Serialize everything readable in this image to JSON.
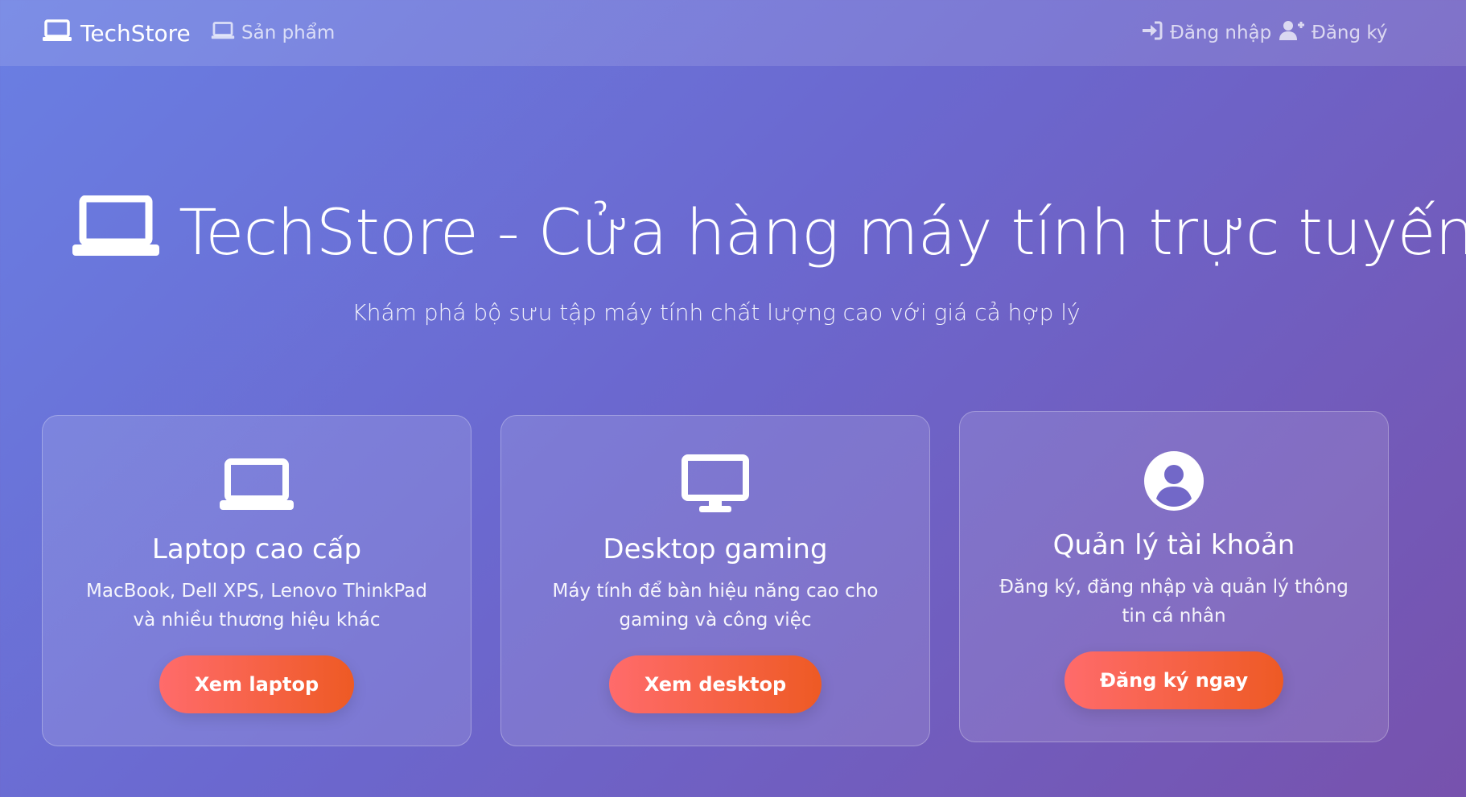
{
  "navbar": {
    "brand": "TechStore",
    "brand_icon": "laptop-icon",
    "products": "Sản phẩm",
    "products_icon": "laptop-icon",
    "login": "Đăng nhập",
    "login_icon": "sign-in-icon",
    "register": "Đăng ký",
    "register_icon": "user-plus-icon"
  },
  "hero": {
    "title": "TechStore - Cửa hàng máy tính trực tuyến",
    "title_icon": "laptop-icon",
    "subtitle": "Khám phá bộ sưu tập máy tính chất lượng cao với giá cả hợp lý"
  },
  "cards": [
    {
      "icon": "laptop-icon",
      "title": "Laptop cao cấp",
      "description": "MacBook, Dell XPS, Lenovo ThinkPad và nhiều thương hiệu khác",
      "button": "Xem laptop"
    },
    {
      "icon": "desktop-icon",
      "title": "Desktop gaming",
      "description": "Máy tính để bàn hiệu năng cao cho gaming và công việc",
      "button": "Xem desktop"
    },
    {
      "icon": "user-circle-icon",
      "title": "Quản lý tài khoản",
      "description": "Đăng ký, đăng nhập và quản lý thông tin cá nhân",
      "button": "Đăng ký ngay"
    }
  ],
  "colors": {
    "background_start": "#6a7fe3",
    "background_end": "#7752ad",
    "button_start": "#ff6b6b",
    "button_end": "#ee5a24"
  }
}
